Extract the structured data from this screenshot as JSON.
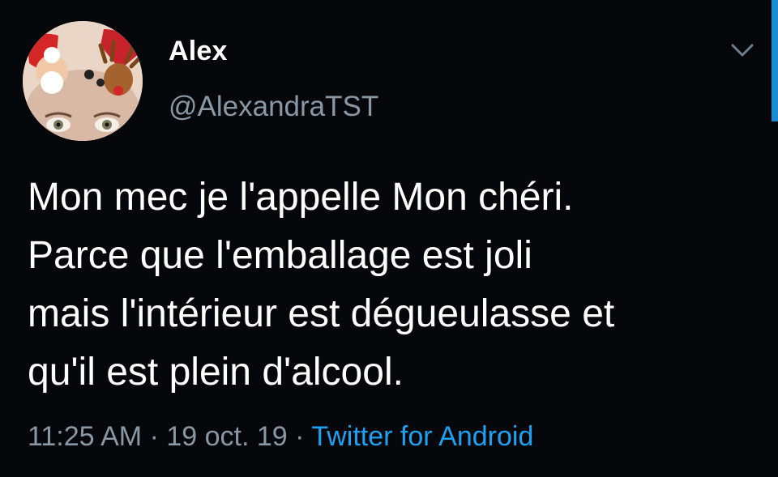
{
  "tweet": {
    "author_name": "Alex",
    "author_handle": "@AlexandraTST",
    "body_lines": [
      "Mon mec je l'appelle Mon chéri.",
      "Parce que l'emballage est joli",
      "mais l'intérieur est dégueulasse et",
      "qu'il est plein d'alcool."
    ],
    "time": "11:25 AM",
    "separator": "·",
    "date": "19 oct. 19",
    "source": "Twitter for Android",
    "menu_icon": "chevron-down-icon"
  },
  "colors": {
    "background": "#05070a",
    "text": "#ffffff",
    "muted": "#8a98a6",
    "link": "#1da1f2"
  }
}
